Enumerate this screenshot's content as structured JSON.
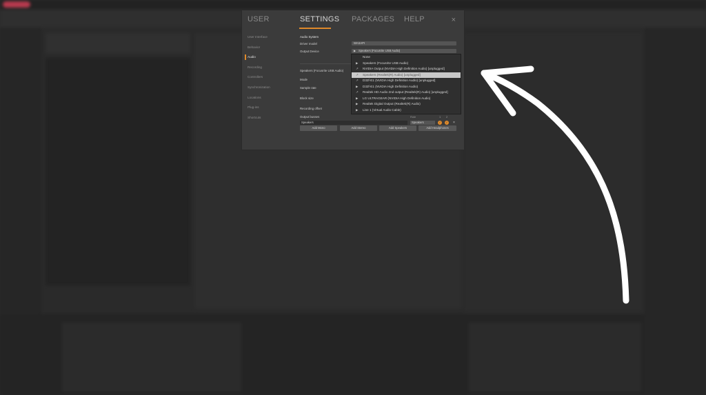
{
  "dialog": {
    "tabs": [
      {
        "label": "USER",
        "active": false
      },
      {
        "label": "SETTINGS",
        "active": true
      },
      {
        "label": "PACKAGES",
        "active": false
      },
      {
        "label": "HELP",
        "active": false
      }
    ],
    "close_label": "×",
    "nav": [
      {
        "label": "User Interface",
        "active": false
      },
      {
        "label": "Behavior",
        "active": false
      },
      {
        "label": "Audio",
        "active": true
      },
      {
        "label": "Recording",
        "active": false
      },
      {
        "label": "Controllers",
        "active": false
      },
      {
        "label": "Synchronization",
        "active": false
      },
      {
        "label": "Locations",
        "active": false
      },
      {
        "label": "Plug-ins",
        "active": false
      },
      {
        "label": "Shortcuts",
        "active": false
      }
    ],
    "audio": {
      "section_title": "Audio System",
      "driver_model_label": "Driver model",
      "driver_model_value": "WASAPI",
      "output_device_label": "Output Device",
      "output_device_value": "Speakers (Focusrite USB Audio)",
      "device_heading": "Speakers (Focusrite USB Audio)",
      "mode_label": "Mode",
      "sample_rate_label": "Sample rate",
      "block_size_label": "Block size",
      "recording_offset_label": "Recording offset",
      "output_busses_label": "Output busses",
      "role_header": "Role",
      "col_1": "1",
      "col_2": "2",
      "bus_name": "Speakers",
      "bus_role": "Speakers",
      "bus_ch1": "✓",
      "bus_ch2": "✓",
      "remove_label": "×",
      "add_buttons": [
        "Add Mono",
        "Add Stereo",
        "Add Speakers",
        "Add Headphones"
      ]
    }
  },
  "dropdown": {
    "items": [
      {
        "label": "None",
        "icon": "",
        "highlighted": false
      },
      {
        "label": "Speakers (Focusrite USB Audio)",
        "icon": "▶",
        "highlighted": false
      },
      {
        "label": "NVIDIA Output (NVIDIA High Definition Audio) [unplugged]",
        "icon": "↗",
        "highlighted": false
      },
      {
        "label": "Speakers (Realtek(R) Audio) [unplugged]",
        "icon": "↗",
        "highlighted": true
      },
      {
        "label": "D32f-E1 (NVIDIA High Definition Audio) [unplugged]",
        "icon": "↗",
        "highlighted": false
      },
      {
        "label": "D32f-E1 (NVIDIA High Definition Audio)",
        "icon": "▶",
        "highlighted": false
      },
      {
        "label": "Realtek HD Audio 2nd output (Realtek(R) Audio) [unplugged]",
        "icon": "↗",
        "highlighted": false
      },
      {
        "label": "LG ULTRAGEAR (NVIDIA High Definition Audio)",
        "icon": "▶",
        "highlighted": false
      },
      {
        "label": "Realtek Digital Output (Realtek(R) Audio)",
        "icon": "▶",
        "highlighted": false
      },
      {
        "label": "Line 1 (Virtual Audio Cable)",
        "icon": "▶",
        "highlighted": false
      }
    ]
  },
  "colors": {
    "accent": "#e08a2a",
    "dialog_bg": "#3b3b3b",
    "annotation_arrow": "#ffffff"
  }
}
